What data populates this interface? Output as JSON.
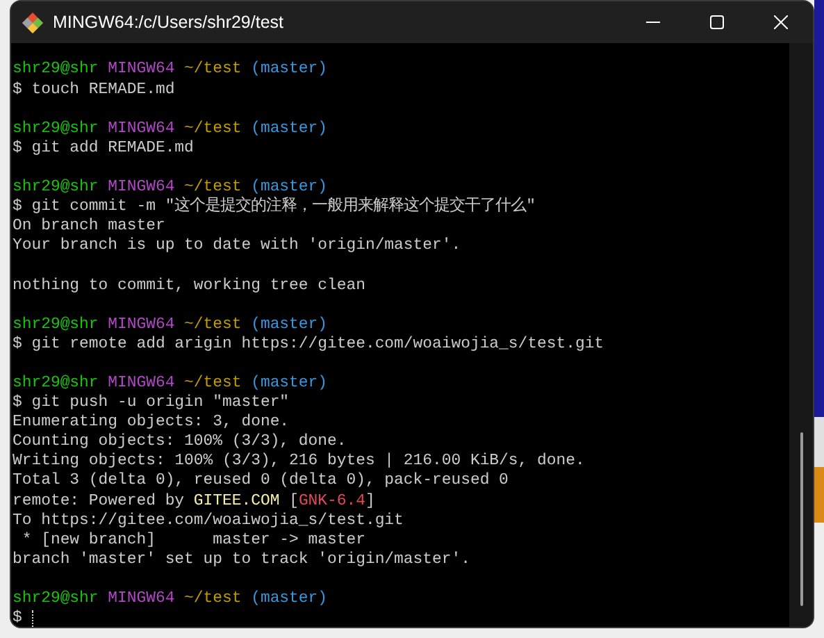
{
  "window": {
    "title": "MINGW64:/c/Users/shr29/test"
  },
  "lines": [
    {
      "kind": "prompt",
      "segments": [
        {
          "text": "shr29@shr",
          "color": "#16c60c"
        },
        {
          "text": "MINGW64",
          "color": "#b148c6"
        },
        {
          "text": "~/test",
          "color": "#c19c00"
        },
        {
          "text": "(master)",
          "color": "#3a96dd"
        }
      ]
    },
    {
      "kind": "text",
      "segments": [
        {
          "text": "$ touch REMADE.md",
          "color": "#cccccc"
        }
      ]
    },
    {
      "kind": "blank"
    },
    {
      "kind": "prompt",
      "segments": [
        {
          "text": "shr29@shr",
          "color": "#16c60c"
        },
        {
          "text": "MINGW64",
          "color": "#b148c6"
        },
        {
          "text": "~/test",
          "color": "#c19c00"
        },
        {
          "text": "(master)",
          "color": "#3a96dd"
        }
      ]
    },
    {
      "kind": "text",
      "segments": [
        {
          "text": "$ git add REMADE.md",
          "color": "#cccccc"
        }
      ]
    },
    {
      "kind": "blank"
    },
    {
      "kind": "prompt",
      "segments": [
        {
          "text": "shr29@shr",
          "color": "#16c60c"
        },
        {
          "text": "MINGW64",
          "color": "#b148c6"
        },
        {
          "text": "~/test",
          "color": "#c19c00"
        },
        {
          "text": "(master)",
          "color": "#3a96dd"
        }
      ]
    },
    {
      "kind": "text",
      "segments": [
        {
          "text": "$ git commit -m \"这个是提交的注释，一般用来解释这个提交干了什么\"",
          "color": "#cccccc"
        }
      ]
    },
    {
      "kind": "text",
      "segments": [
        {
          "text": "On branch master",
          "color": "#cccccc"
        }
      ]
    },
    {
      "kind": "text",
      "segments": [
        {
          "text": "Your branch is up to date with 'origin/master'.",
          "color": "#cccccc"
        }
      ]
    },
    {
      "kind": "blank"
    },
    {
      "kind": "text",
      "segments": [
        {
          "text": "nothing to commit, working tree clean",
          "color": "#cccccc"
        }
      ]
    },
    {
      "kind": "blank"
    },
    {
      "kind": "prompt",
      "segments": [
        {
          "text": "shr29@shr",
          "color": "#16c60c"
        },
        {
          "text": "MINGW64",
          "color": "#b148c6"
        },
        {
          "text": "~/test",
          "color": "#c19c00"
        },
        {
          "text": "(master)",
          "color": "#3a96dd"
        }
      ]
    },
    {
      "kind": "text",
      "segments": [
        {
          "text": "$ git remote add arigin https://gitee.com/woaiwojia_s/test.git",
          "color": "#cccccc"
        }
      ]
    },
    {
      "kind": "blank"
    },
    {
      "kind": "prompt",
      "segments": [
        {
          "text": "shr29@shr",
          "color": "#16c60c"
        },
        {
          "text": "MINGW64",
          "color": "#b148c6"
        },
        {
          "text": "~/test",
          "color": "#c19c00"
        },
        {
          "text": "(master)",
          "color": "#3a96dd"
        }
      ]
    },
    {
      "kind": "text",
      "segments": [
        {
          "text": "$ git push -u origin \"master\"",
          "color": "#cccccc"
        }
      ]
    },
    {
      "kind": "text",
      "segments": [
        {
          "text": "Enumerating objects: 3, done.",
          "color": "#cccccc"
        }
      ]
    },
    {
      "kind": "text",
      "segments": [
        {
          "text": "Counting objects: 100% (3/3), done.",
          "color": "#cccccc"
        }
      ]
    },
    {
      "kind": "text",
      "segments": [
        {
          "text": "Writing objects: 100% (3/3), 216 bytes | 216.00 KiB/s, done.",
          "color": "#cccccc"
        }
      ]
    },
    {
      "kind": "text",
      "segments": [
        {
          "text": "Total 3 (delta 0), reused 0 (delta 0), pack-reused 0",
          "color": "#cccccc"
        }
      ]
    },
    {
      "kind": "text",
      "segments": [
        {
          "text": "remote: Powered by ",
          "color": "#cccccc"
        },
        {
          "text": "GITEE.COM",
          "color": "#f9f1a5"
        },
        {
          "text": " [",
          "color": "#cccccc"
        },
        {
          "text": "GNK-6.4",
          "color": "#e74856"
        },
        {
          "text": "]",
          "color": "#cccccc"
        }
      ]
    },
    {
      "kind": "text",
      "segments": [
        {
          "text": "To https://gitee.com/woaiwojia_s/test.git",
          "color": "#cccccc"
        }
      ]
    },
    {
      "kind": "text",
      "segments": [
        {
          "text": " * [new branch]      master -> master",
          "color": "#cccccc"
        }
      ]
    },
    {
      "kind": "text",
      "segments": [
        {
          "text": "branch 'master' set up to track 'origin/master'.",
          "color": "#cccccc"
        }
      ]
    },
    {
      "kind": "blank"
    },
    {
      "kind": "prompt",
      "segments": [
        {
          "text": "shr29@shr",
          "color": "#16c60c"
        },
        {
          "text": "MINGW64",
          "color": "#b148c6"
        },
        {
          "text": "~/test",
          "color": "#c19c00"
        },
        {
          "text": "(master)",
          "color": "#3a96dd"
        }
      ]
    },
    {
      "kind": "input",
      "segments": [
        {
          "text": "$",
          "color": "#cccccc"
        }
      ]
    }
  ]
}
